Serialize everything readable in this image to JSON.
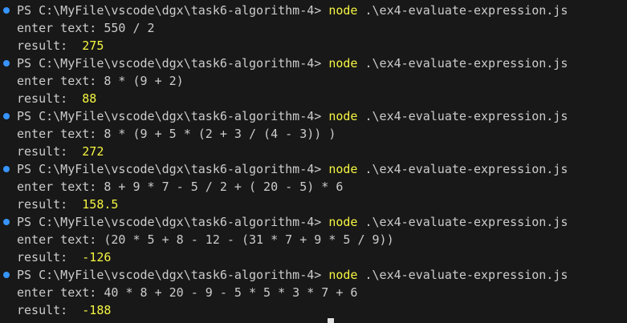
{
  "terminal": {
    "entries": [
      {
        "prompt": "PS C:\\MyFile\\vscode\\dgx\\task6-algorithm-4> ",
        "command": "node",
        "args": " .\\ex4-evaluate-expression.js",
        "input_label": "enter text: ",
        "input": "550 / 2",
        "result_label": "result:  ",
        "result": "275"
      },
      {
        "prompt": "PS C:\\MyFile\\vscode\\dgx\\task6-algorithm-4> ",
        "command": "node",
        "args": " .\\ex4-evaluate-expression.js",
        "input_label": "enter text: ",
        "input": "8 * (9 + 2)",
        "result_label": "result:  ",
        "result": "88"
      },
      {
        "prompt": "PS C:\\MyFile\\vscode\\dgx\\task6-algorithm-4> ",
        "command": "node",
        "args": " .\\ex4-evaluate-expression.js",
        "input_label": "enter text: ",
        "input": "8 * (9 + 5 * (2 + 3 / (4 - 3)) )",
        "result_label": "result:  ",
        "result": "272"
      },
      {
        "prompt": "PS C:\\MyFile\\vscode\\dgx\\task6-algorithm-4> ",
        "command": "node",
        "args": " .\\ex4-evaluate-expression.js",
        "input_label": "enter text: ",
        "input": "8 + 9 * 7 - 5 / 2 + ( 20 - 5) * 6",
        "result_label": "result:  ",
        "result": "158.5"
      },
      {
        "prompt": "PS C:\\MyFile\\vscode\\dgx\\task6-algorithm-4> ",
        "command": "node",
        "args": " .\\ex4-evaluate-expression.js",
        "input_label": "enter text: ",
        "input": "(20 * 5 + 8 - 12 - (31 * 7 + 9 * 5 / 9))",
        "result_label": "result:  ",
        "result": "-126"
      },
      {
        "prompt": "PS C:\\MyFile\\vscode\\dgx\\task6-algorithm-4> ",
        "command": "node",
        "args": " .\\ex4-evaluate-expression.js",
        "input_label": "enter text: ",
        "input": "40 * 8 + 20 - 9 - 5 * 5 * 3 * 7 + 6",
        "result_label": "result:  ",
        "result": "-188"
      }
    ]
  },
  "colors": {
    "background": "#181818",
    "text": "#cccccc",
    "command": "#f5f543",
    "number": "#f5f543",
    "dot": "#3794ff"
  }
}
